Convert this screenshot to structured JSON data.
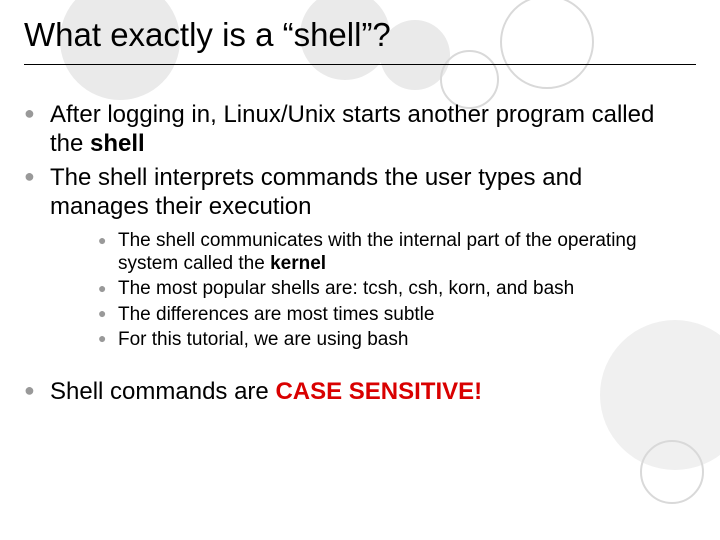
{
  "title": "What exactly is a “shell”?",
  "bullets": {
    "a_pre": "After logging in, Linux/Unix starts another program called the ",
    "a_bold": "shell",
    "b": "The shell interprets commands the user types and manages their execution",
    "sub1_pre": "The shell communicates with the internal part of the operating system called the ",
    "sub1_bold": "kernel",
    "sub2": "The most popular shells are: tcsh, csh, korn, and bash",
    "sub3": "The differences are most times subtle",
    "sub4": "For this tutorial, we are using bash",
    "c_pre": "Shell commands are ",
    "c_bold": "CASE SENSITIVE!"
  },
  "colors": {
    "circle_light": "#eaeaea",
    "circle_medium": "#d9d9d9",
    "accent_red": "#d90000"
  }
}
